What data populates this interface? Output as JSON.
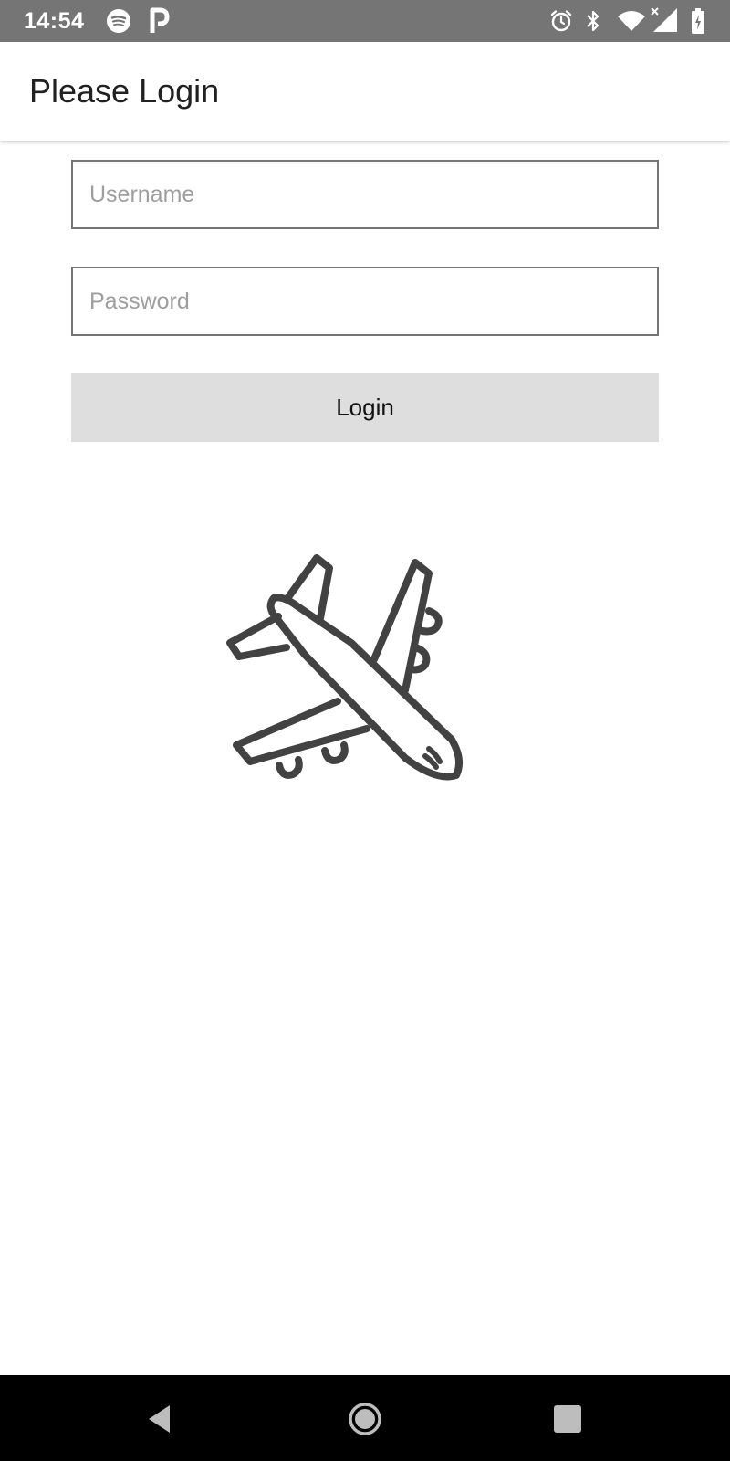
{
  "status_bar": {
    "time": "14:54",
    "left_icons": [
      "spotify-icon",
      "parking-p-icon"
    ],
    "right_icons": [
      "alarm-icon",
      "bluetooth-icon",
      "wifi-icon",
      "signal-no-data-icon",
      "battery-charging-icon"
    ],
    "background": "#757575"
  },
  "app_bar": {
    "title": "Please Login"
  },
  "form": {
    "username_placeholder": "Username",
    "username_value": "",
    "password_placeholder": "Password",
    "password_value": "",
    "login_label": "Login",
    "button_color": "#dedede",
    "border_color": "#757575"
  },
  "illustration": {
    "icon": "airplane-icon",
    "color": "#424242"
  },
  "nav_bar": {
    "buttons": [
      "back-icon",
      "home-icon",
      "recents-icon"
    ]
  }
}
